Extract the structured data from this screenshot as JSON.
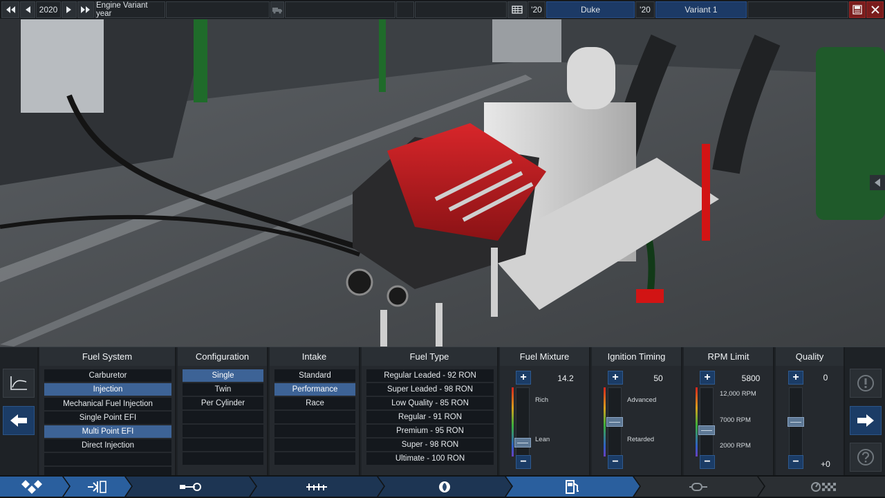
{
  "topbar": {
    "year": "2020",
    "year_label": "Engine Variant year",
    "family_year": "'20",
    "family_name": "Duke",
    "variant_year": "'20",
    "variant_name": "Variant 1"
  },
  "columns": {
    "fuel_system": {
      "title": "Fuel System",
      "group1": [
        "Carburetor",
        "Injection"
      ],
      "group1_selected": 1,
      "group2": [
        "Mechanical Fuel Injection",
        "Single Point EFI",
        "Multi Point EFI",
        "Direct Injection"
      ],
      "group2_selected": 2
    },
    "configuration": {
      "title": "Configuration",
      "options": [
        "Single",
        "Twin",
        "Per Cylinder"
      ],
      "selected": 0
    },
    "intake": {
      "title": "Intake",
      "options": [
        "Standard",
        "Performance",
        "Race"
      ],
      "selected": 1
    },
    "fuel_type": {
      "title": "Fuel Type",
      "options": [
        "Regular Leaded - 92 RON",
        "Super Leaded - 98 RON",
        "Low Quality - 85 RON",
        "Regular - 91 RON",
        "Premium - 95 RON",
        "Super - 98 RON",
        "Ultimate - 100 RON"
      ]
    },
    "fuel_mixture": {
      "title": "Fuel Mixture",
      "value": "14.2",
      "top_label": "Rich",
      "bottom_label": "Lean",
      "level": 0.2
    },
    "ignition_timing": {
      "title": "Ignition Timing",
      "value": "50",
      "top_label": "Advanced",
      "bottom_label": "Retarded",
      "level": 0.5
    },
    "rpm_limit": {
      "title": "RPM Limit",
      "value": "5800",
      "top_label": "12,000 RPM",
      "mid_label": "7000 RPM",
      "bottom_label": "2000 RPM",
      "level": 0.38
    },
    "quality": {
      "title": "Quality",
      "value": "0",
      "bottom_value": "+0",
      "level": 0.5
    }
  },
  "colors": {
    "accent_blue": "#1b3c66",
    "selected_option": "#3d6396",
    "active_tab": "#2a5f9e",
    "tab_inactive": "#1d3553"
  },
  "icons": {
    "prev_decade": "double-left-arrow",
    "prev_year": "left-arrow",
    "next_year": "right-arrow",
    "next_decade": "double-right-arrow",
    "export": "truck-icon",
    "list": "list-icon",
    "close": "close-icon",
    "graph": "graph-icon",
    "back": "arrow-left",
    "warning": "exclamation-icon",
    "forward": "arrow-right",
    "help": "question-icon"
  }
}
